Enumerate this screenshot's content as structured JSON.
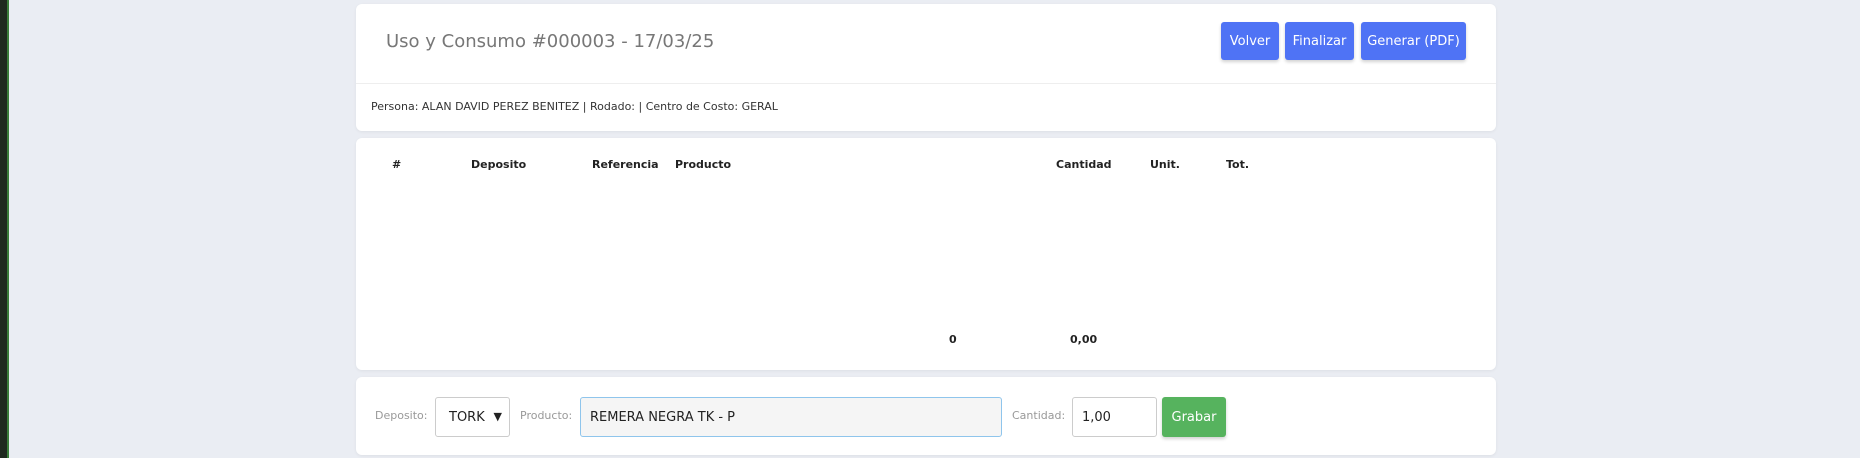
{
  "header": {
    "title": "Uso y Consumo #000003 - 17/03/25",
    "buttons": {
      "volver": "Volver",
      "finalizar": "Finalizar",
      "pdf": "Generar (PDF)"
    },
    "info": "Persona: ALAN DAVID PEREZ BENITEZ | Rodado: | Centro de Costo: GERAL"
  },
  "table": {
    "columns": [
      "#",
      "Deposito",
      "Referencia",
      "Producto",
      "Cantidad",
      "Unit.",
      "Tot."
    ],
    "rows": [],
    "totals": {
      "cantidad": "0",
      "valor": "0,00"
    }
  },
  "form": {
    "deposito_label": "Deposito:",
    "deposito_value": "TORK",
    "producto_label": "Producto:",
    "producto_value": "REMERA NEGRA TK - P",
    "cantidad_label": "Cantidad:",
    "cantidad_value": "1,00",
    "grabar_label": "Grabar"
  },
  "colors": {
    "primary_button": "#4f73f5",
    "success_button": "#56b35e",
    "page_background": "#eaedf3"
  }
}
